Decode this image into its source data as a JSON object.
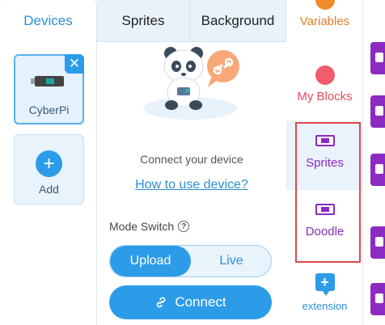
{
  "tabs": [
    {
      "label": "Devices",
      "active": true
    },
    {
      "label": "Sprites",
      "active": false
    },
    {
      "label": "Background",
      "active": false
    }
  ],
  "devices": {
    "selected": {
      "label": "CyberPi",
      "close_icon": "close-icon"
    },
    "add": {
      "label": "Add",
      "icon": "plus-icon"
    }
  },
  "connection": {
    "message": "Connect your device",
    "help_link": "How to use device?",
    "mode_label": "Mode Switch",
    "mode_help_icon": "help-circle-icon",
    "modes": [
      {
        "label": "Upload",
        "selected": true
      },
      {
        "label": "Live",
        "selected": false
      }
    ],
    "connect_label": "Connect",
    "connect_icon": "link-icon"
  },
  "categories": [
    {
      "label": "Variables",
      "color": "#f08c2c"
    },
    {
      "label": "My Blocks",
      "color": "#f05d6c"
    },
    {
      "label": "Sprites",
      "color": "#8b2bc2",
      "selected": true,
      "icon": "sprite-icon"
    },
    {
      "label": "Doodle",
      "color": "#8b2bc2",
      "icon": "doodle-icon"
    }
  ],
  "extension": {
    "label": "extension",
    "icon": "add-extension-icon"
  },
  "colors": {
    "accent": "#2d9ce8",
    "highlight": "#e0484b",
    "purple": "#8b2bc2"
  }
}
